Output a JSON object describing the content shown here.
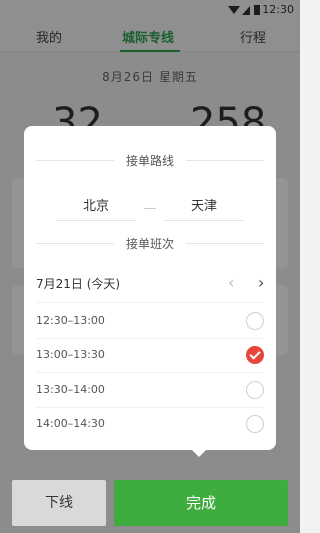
{
  "status": {
    "time": "12:30"
  },
  "tabs": [
    {
      "label": "我的"
    },
    {
      "label": "城际专线"
    },
    {
      "label": "行程"
    }
  ],
  "date_line": "8月26日  星期五",
  "stats": {
    "left": "32",
    "right": "258"
  },
  "modal": {
    "route_title": "接单路线",
    "from_city": "北京",
    "to_city": "天津",
    "schedule_title": "接单班次",
    "day_label": "7月21日 (今天)",
    "nav_prev": "‹",
    "nav_next": "›",
    "slots": [
      {
        "time": "12:30–13:00",
        "selected": false
      },
      {
        "time": "13:00–13:30",
        "selected": true
      },
      {
        "time": "13:30–14:00",
        "selected": false
      },
      {
        "time": "14:00–14:30",
        "selected": false
      }
    ]
  },
  "bottom": {
    "offline_label": "下线",
    "done_label": "完成"
  },
  "colors": {
    "accent": "#3fac3f",
    "selected": "#e8463a",
    "tab_active": "#2ea44f"
  }
}
